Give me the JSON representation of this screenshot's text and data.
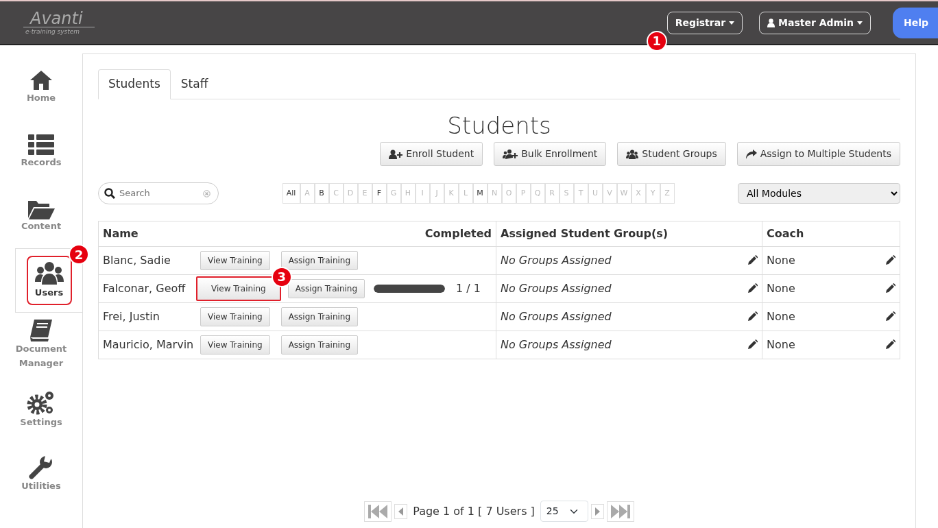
{
  "header": {
    "logo": {
      "name": "Avanti",
      "tagline": "e-training system"
    },
    "menus": [
      {
        "label": "Registrar",
        "callout": "1"
      },
      {
        "label": "Master Admin"
      }
    ],
    "help": "Help"
  },
  "sidebar": {
    "items": [
      {
        "label": "Home",
        "selected": false,
        "highlighted": false
      },
      {
        "label": "Records",
        "selected": false,
        "highlighted": false
      },
      {
        "label": "Content",
        "selected": false,
        "highlighted": false
      },
      {
        "label": "Users",
        "selected": true,
        "highlighted": true,
        "callout": "2"
      },
      {
        "label": "Document Manager",
        "selected": false,
        "highlighted": false
      },
      {
        "label": "Settings",
        "selected": false,
        "highlighted": false
      },
      {
        "label": "Utilities",
        "selected": false,
        "highlighted": false
      }
    ]
  },
  "tabs": [
    {
      "label": "Students",
      "selected": true
    },
    {
      "label": "Staff",
      "selected": false
    }
  ],
  "title": "Students",
  "actions": [
    "Enroll Student",
    "Bulk Enrollment",
    "Student Groups",
    "Assign to Multiple Students"
  ],
  "search": {
    "placeholder": "Search"
  },
  "letters": [
    {
      "label": "All",
      "enabled": true
    },
    {
      "label": "A",
      "enabled": false
    },
    {
      "label": "B",
      "enabled": true
    },
    {
      "label": "C",
      "enabled": false
    },
    {
      "label": "D",
      "enabled": false
    },
    {
      "label": "E",
      "enabled": false
    },
    {
      "label": "F",
      "enabled": true
    },
    {
      "label": "G",
      "enabled": false
    },
    {
      "label": "H",
      "enabled": false
    },
    {
      "label": "I",
      "enabled": false
    },
    {
      "label": "J",
      "enabled": false
    },
    {
      "label": "K",
      "enabled": false
    },
    {
      "label": "L",
      "enabled": false
    },
    {
      "label": "M",
      "enabled": true
    },
    {
      "label": "N",
      "enabled": false
    },
    {
      "label": "O",
      "enabled": false
    },
    {
      "label": "P",
      "enabled": false
    },
    {
      "label": "Q",
      "enabled": false
    },
    {
      "label": "R",
      "enabled": false
    },
    {
      "label": "S",
      "enabled": false
    },
    {
      "label": "T",
      "enabled": false
    },
    {
      "label": "U",
      "enabled": false
    },
    {
      "label": "V",
      "enabled": false
    },
    {
      "label": "W",
      "enabled": false
    },
    {
      "label": "X",
      "enabled": false
    },
    {
      "label": "Y",
      "enabled": false
    },
    {
      "label": "Z",
      "enabled": false
    }
  ],
  "module_filter": "All Modules",
  "table": {
    "columns": [
      "Name",
      "Completed",
      "Assigned Student Group(s)",
      "Coach"
    ],
    "rows": [
      {
        "name": "Blanc, Sadie",
        "view": {
          "label": "View Training",
          "highlighted": false
        },
        "assign": "Assign Training",
        "groups": "No Groups Assigned",
        "coach": "None"
      },
      {
        "name": "Falconar, Geoff",
        "view": {
          "label": "View Training",
          "highlighted": true,
          "callout": "3"
        },
        "assign": "Assign Training",
        "progress": {
          "level": 1,
          "reading": "1 / 1"
        },
        "groups": "No Groups Assigned",
        "coach": "None"
      },
      {
        "name": "Frei, Justin",
        "view": {
          "label": "View Training",
          "highlighted": false
        },
        "assign": "Assign Training",
        "groups": "No Groups Assigned",
        "coach": "None"
      },
      {
        "name": "Mauricio, Marvin",
        "view": {
          "label": "View Training",
          "highlighted": false
        },
        "assign": "Assign Training",
        "groups": "No Groups Assigned",
        "coach": "None"
      }
    ]
  },
  "pager": {
    "info": "Page 1 of 1 [ 7 Users ]",
    "page_size": "25"
  }
}
